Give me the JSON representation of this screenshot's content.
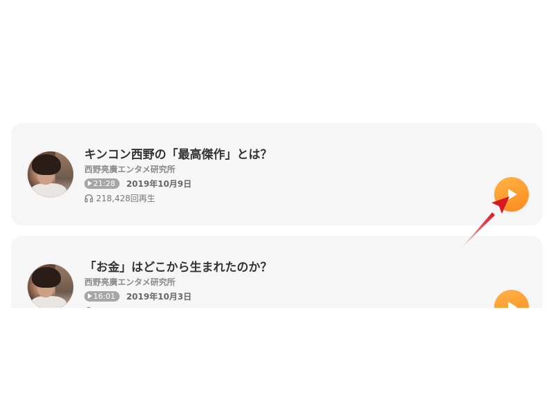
{
  "episodes": [
    {
      "title": "キンコン西野の「最高傑作」とは？",
      "channel": "西野亮廣エンタメ研究所",
      "duration": "21:28",
      "date": "2019年10月9日",
      "plays": "218,428回再生"
    },
    {
      "title": "「お金」はどこから生まれたのか？",
      "channel": "西野亮廣エンタメ研究所",
      "duration": "16:01",
      "date": "2019年10月3日",
      "plays": ""
    }
  ],
  "colors": {
    "card_bg": "#f6f6f7",
    "play_button": "#fa8a1e",
    "annotation_arrow": "#e0202a"
  },
  "icons": {
    "duration": "play-triangle-icon",
    "plays": "headphones-icon",
    "play_button": "play-icon"
  }
}
